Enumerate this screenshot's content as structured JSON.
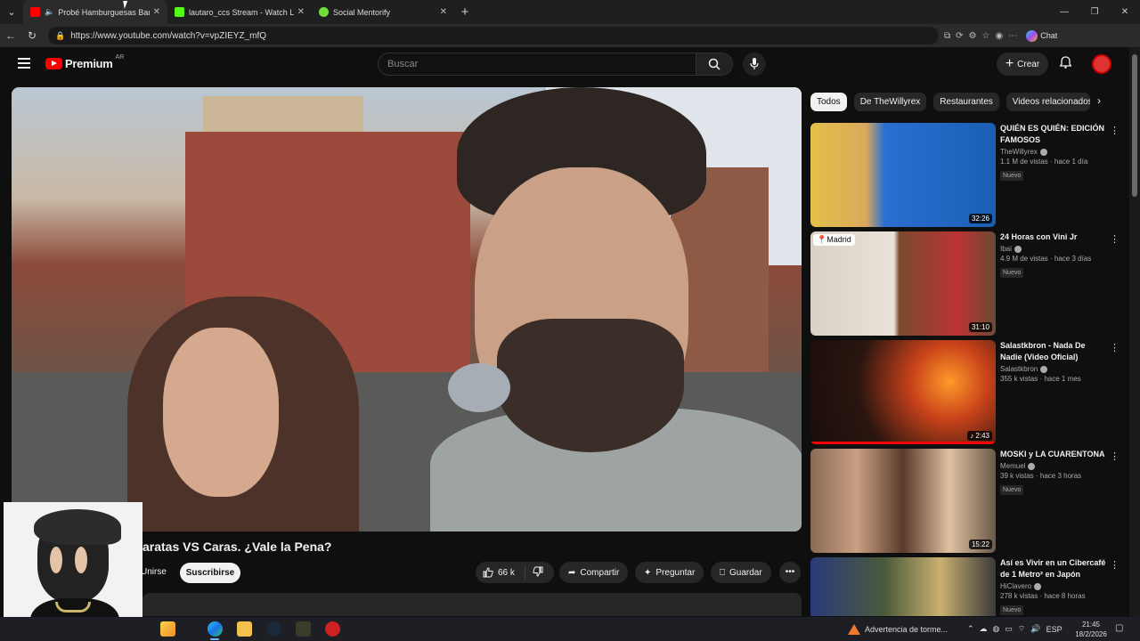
{
  "browser": {
    "tabs": [
      {
        "title": "Probé Hamburguesas Baratas",
        "active": true,
        "favicon_color": "#ff0000",
        "audio": true
      },
      {
        "title": "lautaro_ccs Stream - Watch Live o",
        "active": false,
        "favicon_color": "#53fc18"
      },
      {
        "title": "Social Mentorify",
        "active": false,
        "favicon_color": "#6fdc3c"
      }
    ],
    "url": "https://www.youtube.com/watch?v=vpZIEYZ_mfQ",
    "copilot_label": "Chat"
  },
  "youtube": {
    "logo_text": "Premium",
    "country": "AR",
    "search_placeholder": "Buscar",
    "create_label": "Crear",
    "video_title": "aratas VS Caras. ¿Vale la Pena?",
    "join_label": "Unirse",
    "subscribe_label": "Suscribirse",
    "likes": "66 k",
    "share_label": "Compartir",
    "ask_label": "Preguntar",
    "save_label": "Guardar",
    "chips": [
      "Todos",
      "De TheWillyrex",
      "Restaurantes",
      "Videos relacionados"
    ],
    "recommendations": [
      {
        "title": "QUIÉN ES QUIÉN: EDICIÓN FAMOSOS",
        "channel": "TheWillyrex",
        "stats": "1.1 M de vistas · hace 1 día",
        "badge": "Nuevo",
        "duration": "32:26",
        "thumb_color": "#1a5fb4"
      },
      {
        "title": "24 Horas con Vini Jr",
        "channel": "Ibai",
        "stats": "4.9 M de vistas · hace 3 días",
        "badge": "Nuevo",
        "duration": "31:10",
        "location": "Madrid",
        "thumb_color": "#8a6a52"
      },
      {
        "title": "Salastkbron - Nada De Nadie (Video Oficial)",
        "channel": "Salastkbron",
        "stats": "355 k vistas · hace 1 mes",
        "badge": "",
        "duration": "2:43",
        "thumb_color": "#3a1d14"
      },
      {
        "title": "MOSKI y LA CUARENTONA",
        "channel": "Memuel",
        "stats": "39 k vistas · hace 3 horas",
        "badge": "Nuevo",
        "duration": "15:22",
        "thumb_color": "#5c4a3d"
      },
      {
        "title": "Así es Vivir en un Cibercafé de 1 Metro² en Japón",
        "channel": "HiClavero",
        "stats": "278 k vistas · hace 8 horas",
        "badge": "Nuevo",
        "duration": "",
        "thumb_color": "#4a5a3a"
      }
    ]
  },
  "taskbar": {
    "weather_text": "Advertencia de torme...",
    "lang": "ESP",
    "time": "21:45",
    "date": "18/2/2026"
  }
}
